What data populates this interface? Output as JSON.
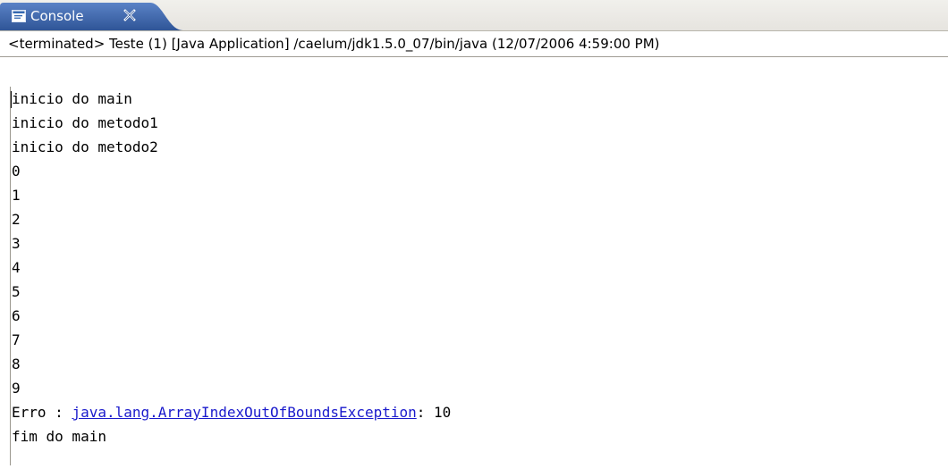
{
  "tab": {
    "label": "Console",
    "icon": "console-icon",
    "close_icon": "close-icon",
    "color": "#3a5f9c"
  },
  "description": "<terminated> Teste (1) [Java Application] /caelum/jdk1.5.0_07/bin/java (12/07/2006 4:59:00 PM)",
  "output": {
    "lines": [
      "inicio do main",
      "inicio do metodo1",
      "inicio do metodo2",
      "0",
      "1",
      "2",
      "3",
      "4",
      "5",
      "6",
      "7",
      "8",
      "9"
    ],
    "error_prefix": "Erro : ",
    "error_link": "java.lang.ArrayIndexOutOfBoundsException",
    "error_suffix": ": 10",
    "last_line": "fim do main",
    "link_color": "#1a1acc"
  }
}
